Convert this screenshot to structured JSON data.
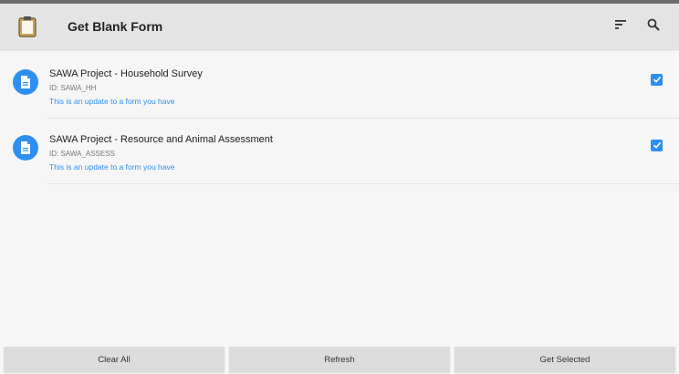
{
  "toolbar": {
    "title": "Get Blank Form",
    "app_icon": "clipboard-icon",
    "sort_icon": "sort-icon",
    "search_icon": "search-icon"
  },
  "forms": [
    {
      "title": "SAWA Project - Household Survey",
      "id_text": "ID: SAWA_HH",
      "note": "This is an update to a form you have",
      "checked": true
    },
    {
      "title": "SAWA Project - Resource and Animal Assessment",
      "id_text": "ID: SAWA_ASSESS",
      "note": "This is an update to a form you have",
      "checked": true
    }
  ],
  "buttons": {
    "clear_all": "Clear All",
    "refresh": "Refresh",
    "get_selected": "Get Selected"
  },
  "colors": {
    "accent": "#2f8ff0",
    "toolbar_bg": "#e4e4e4",
    "button_bg": "#dcdcdc",
    "clipboard": "#c8a35a"
  }
}
